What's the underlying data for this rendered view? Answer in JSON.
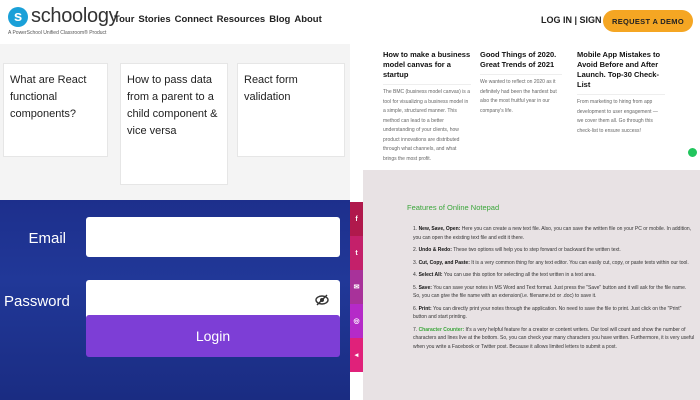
{
  "header": {
    "logo_text": "schoology",
    "logo_tagline": "A PowerSchool Unified Classroom® Product",
    "nav": [
      "Tour",
      "Stories",
      "Connect",
      "Resources",
      "Blog",
      "About"
    ],
    "login_signup": "LOG IN | SIGN UP",
    "demo_button": "REQUEST A DEMO"
  },
  "questions": [
    "What are React functional components?",
    "How to pass data from a parent to a child component & vice versa",
    "React form validation"
  ],
  "blogs": [
    {
      "title": "How to make a business model canvas for a startup",
      "excerpt": "The BMC (business model canvas) is a tool for visualizing a business model in a simple, structured manner. This method can lead to a better understanding of your clients, how product innovations are distributed through what channels, and what brings the most profit."
    },
    {
      "title": "Good Things of 2020. Great Trends of 2021",
      "excerpt": "We wanted to reflect on 2020 as it definitely had been the hardest but also the most fruitful year in our company's life."
    },
    {
      "title": "Mobile App Mistakes to Avoid Before and After Launch. Top-30 Check-List",
      "excerpt": "From marketing to hiring from app development to user engagement — we cover them all. Go through this check-list to ensure success!"
    }
  ],
  "login_form": {
    "email_label": "Email",
    "password_label": "Password",
    "login_button": "Login"
  },
  "social_icons": [
    "facebook-icon",
    "twitter-icon",
    "email-icon",
    "whatsapp-icon",
    "share-icon"
  ],
  "social_glyphs": [
    "f",
    "t",
    "✉",
    "◎",
    "◂"
  ],
  "social_colors": [
    "#b0194c",
    "#c4206a",
    "#a8329a",
    "#b52ac8",
    "#e0217a"
  ],
  "notepad": {
    "title": "Features of Online Notepad",
    "items": [
      {
        "num": "1.",
        "key": "New, Save, Open:",
        "text": "Here you can create a new text file. Also, you can save the written file on your PC or mobile. In addition, you can open the existing text file and edit it there."
      },
      {
        "num": "2.",
        "key": "Undo & Redo:",
        "text": "These two options will help you to step forward or backward the written text."
      },
      {
        "num": "3.",
        "key": "Cut, Copy, and Paste:",
        "text": "It is a very common thing for any text editor. You can easily cut, copy, or paste texts within our tool."
      },
      {
        "num": "4.",
        "key": "Select All:",
        "text": "You can use this option for selecting all the text written in a text area."
      },
      {
        "num": "5.",
        "key": "Save:",
        "text": "You can save your notes in MS Word and Text format. Just press the \"Save\" button and it will ask for the file name. So, you can give the file name with an extension(i.e. filename.txt or .doc) to save it."
      },
      {
        "num": "6.",
        "key": "Print:",
        "text": "You can directly print your notes through the application. No need to save the file to print. Just click on the \"Print\" button and start printing."
      },
      {
        "num": "7.",
        "key": "Character Counter:",
        "text": "It's a very helpful feature for a creator or content writers. Our tool will count and show the number of characters and lines live at the bottom. So, you can check your many characters you have written. Furthermore, it is very useful when you write a Facebook or Twitter post. Because it allows limited letters to submit a post."
      }
    ]
  }
}
